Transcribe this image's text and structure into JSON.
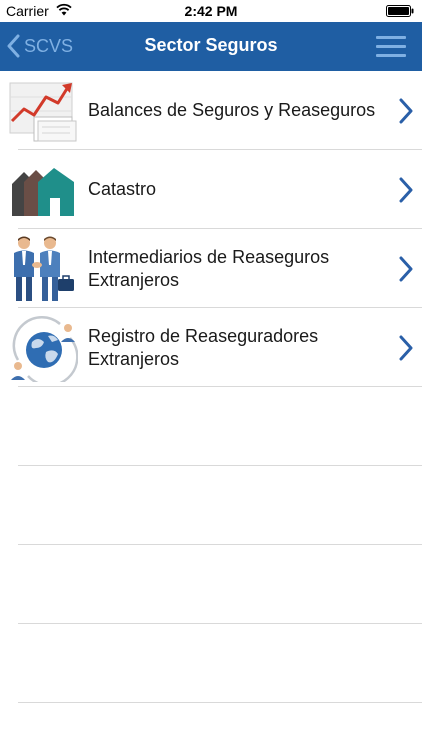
{
  "status_bar": {
    "carrier": "Carrier",
    "time": "2:42 PM"
  },
  "nav": {
    "back_label": "SCVS",
    "title": "Sector Seguros"
  },
  "items": [
    {
      "label": "Balances de Seguros y Reaseguros",
      "icon": "chart-growth-icon"
    },
    {
      "label": "Catastro",
      "icon": "houses-icon"
    },
    {
      "label": "Intermediarios de Reaseguros Extranjeros",
      "icon": "businessmen-handshake-icon"
    },
    {
      "label": "Registro de Reaseguradores Extranjeros",
      "icon": "globe-people-icon"
    }
  ],
  "colors": {
    "nav_background": "#1f5ea3",
    "nav_accent": "#7fb0e3",
    "chevron": "#2a5fa8"
  }
}
